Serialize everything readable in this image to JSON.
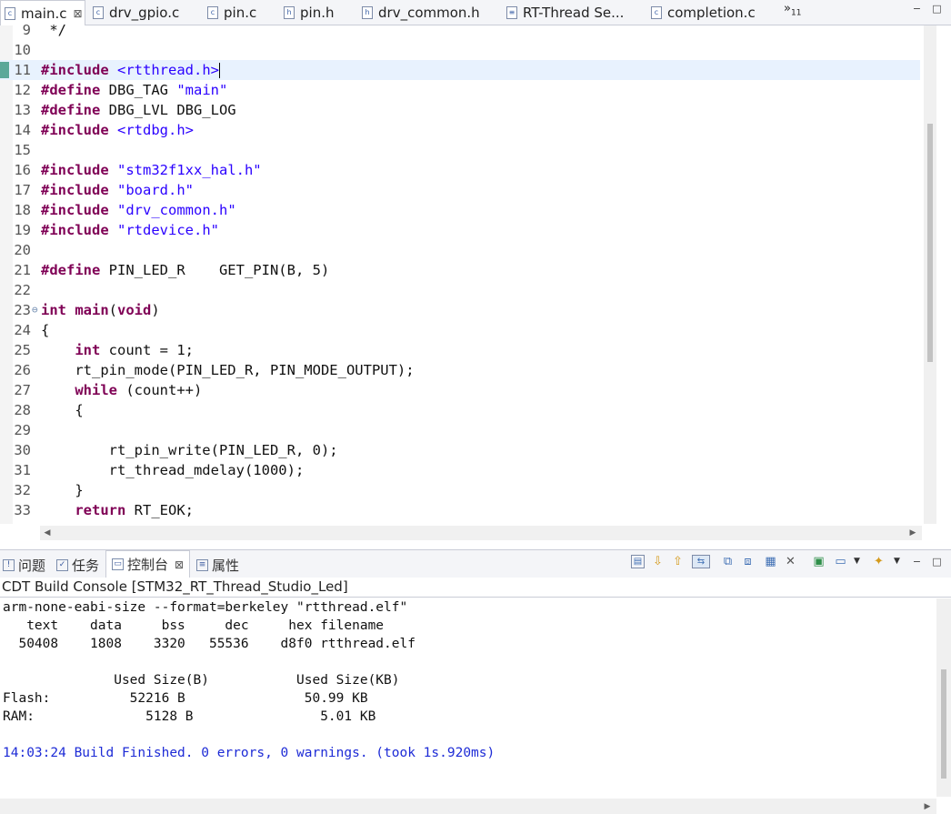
{
  "editor_tabs": [
    {
      "label": "main.c",
      "icon": "c-file-icon",
      "active": true
    },
    {
      "label": "drv_gpio.c",
      "icon": "c-file-icon"
    },
    {
      "label": "pin.c",
      "icon": "c-file-icon"
    },
    {
      "label": "pin.h",
      "icon": "h-file-icon"
    },
    {
      "label": "drv_common.h",
      "icon": "h-file-icon"
    },
    {
      "label": "RT-Thread Se...",
      "icon": "settings-file-icon"
    },
    {
      "label": "completion.c",
      "icon": "c-file-icon"
    }
  ],
  "tab_overflow": {
    "glyph": "»",
    "count": "11"
  },
  "window_buttons": {
    "minimize": "−",
    "maximize": "□"
  },
  "tab_close_glyph": "⊠",
  "code_lines": [
    {
      "n": "9",
      "parts": [
        {
          "t": " */",
          "c": ""
        }
      ]
    },
    {
      "n": "10",
      "parts": []
    },
    {
      "n": "11",
      "parts": [
        {
          "t": "#include",
          "c": "kw"
        },
        {
          "t": " ",
          "c": ""
        },
        {
          "t": "<rtthread.h>",
          "c": "str"
        }
      ],
      "current": true
    },
    {
      "n": "12",
      "parts": [
        {
          "t": "#define",
          "c": "kw"
        },
        {
          "t": " DBG_TAG ",
          "c": ""
        },
        {
          "t": "\"main\"",
          "c": "str"
        }
      ]
    },
    {
      "n": "13",
      "parts": [
        {
          "t": "#define",
          "c": "kw"
        },
        {
          "t": " DBG_LVL DBG_LOG",
          "c": ""
        }
      ]
    },
    {
      "n": "14",
      "parts": [
        {
          "t": "#include",
          "c": "kw"
        },
        {
          "t": " ",
          "c": ""
        },
        {
          "t": "<rtdbg.h>",
          "c": "str"
        }
      ]
    },
    {
      "n": "15",
      "parts": []
    },
    {
      "n": "16",
      "parts": [
        {
          "t": "#include",
          "c": "kw"
        },
        {
          "t": " ",
          "c": ""
        },
        {
          "t": "\"stm32f1xx_hal.h\"",
          "c": "str"
        }
      ]
    },
    {
      "n": "17",
      "parts": [
        {
          "t": "#include",
          "c": "kw"
        },
        {
          "t": " ",
          "c": ""
        },
        {
          "t": "\"board.h\"",
          "c": "str"
        }
      ]
    },
    {
      "n": "18",
      "parts": [
        {
          "t": "#include",
          "c": "kw"
        },
        {
          "t": " ",
          "c": ""
        },
        {
          "t": "\"drv_common.h\"",
          "c": "str"
        }
      ]
    },
    {
      "n": "19",
      "parts": [
        {
          "t": "#include",
          "c": "kw"
        },
        {
          "t": " ",
          "c": ""
        },
        {
          "t": "\"rtdevice.h\"",
          "c": "str"
        }
      ]
    },
    {
      "n": "20",
      "parts": []
    },
    {
      "n": "21",
      "parts": [
        {
          "t": "#define",
          "c": "kw"
        },
        {
          "t": " PIN_LED_R    GET_PIN(B, 5)",
          "c": ""
        }
      ]
    },
    {
      "n": "22",
      "parts": []
    },
    {
      "n": "23",
      "parts": [
        {
          "t": "int",
          "c": "kw"
        },
        {
          "t": " ",
          "c": ""
        },
        {
          "t": "main",
          "c": "kw"
        },
        {
          "t": "(",
          "c": ""
        },
        {
          "t": "void",
          "c": "kw"
        },
        {
          "t": ")",
          "c": ""
        }
      ],
      "fold": "⊖"
    },
    {
      "n": "24",
      "parts": [
        {
          "t": "{",
          "c": ""
        }
      ]
    },
    {
      "n": "25",
      "parts": [
        {
          "t": "    ",
          "c": ""
        },
        {
          "t": "int",
          "c": "kw"
        },
        {
          "t": " count = 1;",
          "c": ""
        }
      ]
    },
    {
      "n": "26",
      "parts": [
        {
          "t": "    rt_pin_mode(PIN_LED_R, PIN_MODE_OUTPUT);",
          "c": ""
        }
      ]
    },
    {
      "n": "27",
      "parts": [
        {
          "t": "    ",
          "c": ""
        },
        {
          "t": "while",
          "c": "kw"
        },
        {
          "t": " (count++)",
          "c": ""
        }
      ]
    },
    {
      "n": "28",
      "parts": [
        {
          "t": "    {",
          "c": ""
        }
      ]
    },
    {
      "n": "29",
      "parts": []
    },
    {
      "n": "30",
      "parts": [
        {
          "t": "        rt_pin_write(PIN_LED_R, 0);",
          "c": ""
        }
      ]
    },
    {
      "n": "31",
      "parts": [
        {
          "t": "        rt_thread_mdelay(1000);",
          "c": ""
        }
      ]
    },
    {
      "n": "32",
      "parts": [
        {
          "t": "    }",
          "c": ""
        }
      ]
    },
    {
      "n": "33",
      "parts": [
        {
          "t": "    ",
          "c": ""
        },
        {
          "t": "return",
          "c": "kw"
        },
        {
          "t": " RT_EOK;",
          "c": ""
        }
      ]
    }
  ],
  "panel_tabs": [
    {
      "label": "问题",
      "icon": "problems-icon"
    },
    {
      "label": "任务",
      "icon": "tasks-icon"
    },
    {
      "label": "控制台",
      "icon": "console-icon",
      "active": true
    },
    {
      "label": "属性",
      "icon": "properties-icon"
    }
  ],
  "console_tools": [
    {
      "name": "open-console-icon",
      "glyph": "▤"
    },
    {
      "name": "next-error-icon",
      "glyph": "⇩"
    },
    {
      "name": "previous-error-icon",
      "glyph": "⇧"
    },
    {
      "name": "link-with-editor-icon",
      "glyph": "⇆"
    },
    {
      "name": "copy-console-icon",
      "glyph": "⧉"
    },
    {
      "name": "paste-console-icon",
      "glyph": "⧈"
    },
    {
      "name": "clear-console-icon",
      "glyph": "▦"
    },
    {
      "name": "remove-launch-icon",
      "glyph": "✕"
    },
    {
      "name": "pin-console-icon",
      "glyph": "▣"
    },
    {
      "name": "display-console-icon",
      "glyph": "▭"
    },
    {
      "name": "new-console-icon",
      "glyph": "✦"
    }
  ],
  "console": {
    "title": "CDT Build Console [STM32_RT_Thread_Studio_Led]",
    "lines": [
      {
        "t": "arm-none-eabi-size --format=berkeley \"rtthread.elf\""
      },
      {
        "t": "   text    data     bss     dec     hex filename"
      },
      {
        "t": "  50408    1808    3320   55536    d8f0 rtthread.elf"
      },
      {
        "t": ""
      },
      {
        "t": "              Used Size(B)           Used Size(KB)"
      },
      {
        "t": "Flash:          52216 B               50.99 KB"
      },
      {
        "t": "RAM:              5128 B                5.01 KB"
      },
      {
        "t": ""
      },
      {
        "t": "14:03:24 Build Finished. 0 errors, 0 warnings. (took 1s.920ms)",
        "blue": true
      }
    ]
  }
}
